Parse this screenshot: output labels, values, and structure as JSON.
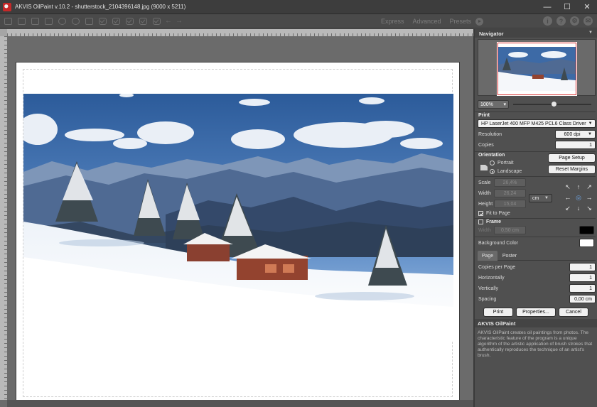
{
  "window": {
    "title": "AKVIS OilPaint v.10.2 - shutterstock_2104396148.jpg (9000 x 5211)",
    "minimize": "—",
    "maximize": "☐",
    "close": "✕"
  },
  "toolbar": {
    "modes": [
      "Express",
      "Advanced",
      "Presets"
    ],
    "icons": [
      "open-icon",
      "save-icon",
      "save-as-icon",
      "print-icon",
      "batch-icon",
      "share-icon",
      "effect-icon",
      "brush-icon",
      "eraser-icon",
      "smudge-icon",
      "history-brush-icon",
      "apply-icon",
      "undo-icon",
      "redo-icon"
    ],
    "right_icons": [
      "about-icon",
      "help-icon",
      "settings-icon",
      "news-icon"
    ],
    "right_glyphs": [
      "i",
      "?",
      "⚙",
      "✉"
    ]
  },
  "navigator": {
    "title": "Navigator",
    "zoom": "100%"
  },
  "print": {
    "title": "Print",
    "printer": "HP LaserJet 400 MFP M425 PCL6 Class Driver",
    "resolution_label": "Resolution",
    "resolution_value": "600 dpi",
    "copies_label": "Copies",
    "copies_value": "1",
    "orientation_label": "Orientation",
    "portrait_label": "Portrait",
    "landscape_label": "Landscape",
    "page_setup": "Page Setup",
    "reset_margins": "Reset Margins",
    "scale_label": "Scale",
    "scale_value": "26,4%",
    "width_label": "Width",
    "width_value": "26,24",
    "height_label": "Height",
    "height_value": "15,04",
    "unit": "cm",
    "fit_to_page": "Fit to Page",
    "frame_label": "Frame",
    "frame_width_label": "Width",
    "frame_width_value": "0,50 cm",
    "frame_color": "#000000",
    "background_color_label": "Background Color",
    "background_color": "#ffffff"
  },
  "page_tabs": {
    "page": "Page",
    "poster": "Poster",
    "copies_per_page_label": "Copies per Page",
    "copies_per_page_value": "1",
    "horizontally_label": "Horizontally",
    "horizontally_value": "1",
    "vertically_label": "Vertically",
    "vertically_value": "1",
    "spacing_label": "Spacing",
    "spacing_value": "0,00 cm"
  },
  "actions": {
    "print": "Print",
    "properties": "Properties...",
    "cancel": "Cancel"
  },
  "description": {
    "title": "AKVIS OilPaint",
    "text": "AKVIS OilPaint creates oil paintings from photos. The characteristic feature of the program is a unique algorithm of the artistic application of brush strokes that authentically reproduces the technique of an artist's brush."
  }
}
